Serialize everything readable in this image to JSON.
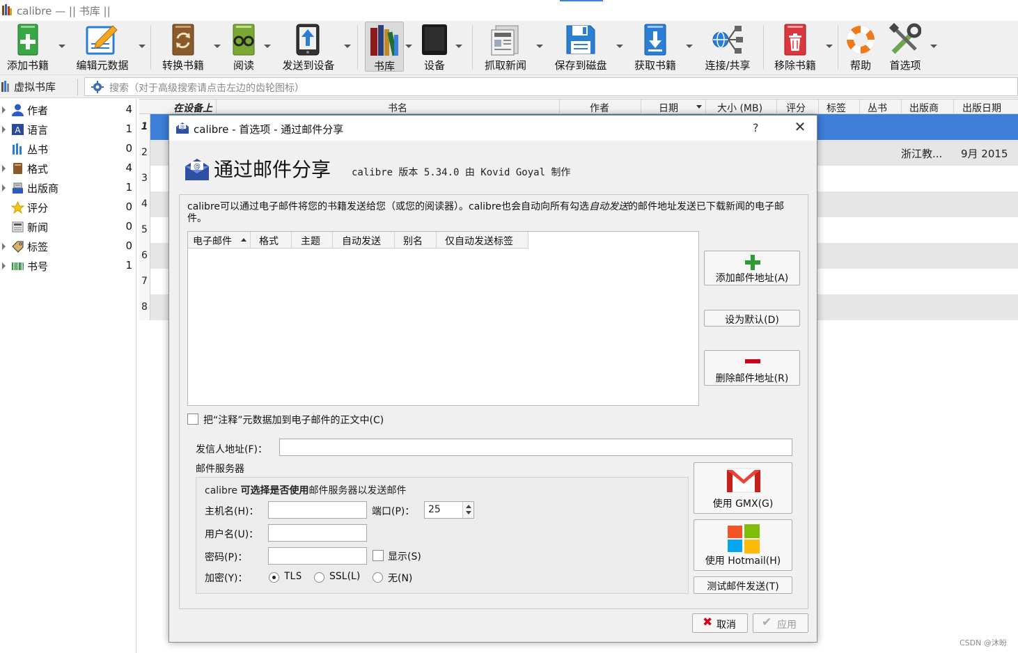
{
  "window": {
    "title": "calibre — || 书库 ||"
  },
  "toolbar": {
    "add_books": "添加书籍",
    "edit_metadata": "编辑元数据",
    "convert_books": "转换书籍",
    "view": "阅读",
    "send_to_device": "发送到设备",
    "library": "书库",
    "device": "设备",
    "fetch_news": "抓取新闻",
    "save_to_disk": "保存到磁盘",
    "get_books": "获取书籍",
    "connect_share": "连接/共享",
    "remove_books": "移除书籍",
    "help": "帮助",
    "preferences": "首选项"
  },
  "search": {
    "virtual_library": "虚拟书库",
    "placeholder": "搜索（对于高级搜索请点击左边的齿轮图标）"
  },
  "tag_browser": {
    "items": [
      {
        "label": "作者",
        "count": "4",
        "expandable": true,
        "icon": "user-icon"
      },
      {
        "label": "语言",
        "count": "1",
        "expandable": true,
        "icon": "language-icon"
      },
      {
        "label": "丛书",
        "count": "0",
        "expandable": false,
        "icon": "series-icon"
      },
      {
        "label": "格式",
        "count": "4",
        "expandable": true,
        "icon": "book-format-icon"
      },
      {
        "label": "出版商",
        "count": "1",
        "expandable": true,
        "icon": "publisher-icon"
      },
      {
        "label": "评分",
        "count": "0",
        "expandable": false,
        "icon": "star-icon"
      },
      {
        "label": "新闻",
        "count": "0",
        "expandable": false,
        "icon": "news-icon"
      },
      {
        "label": "标签",
        "count": "0",
        "expandable": true,
        "icon": "tag-icon"
      },
      {
        "label": "书号",
        "count": "1",
        "expandable": true,
        "icon": "barcode-icon"
      }
    ]
  },
  "book_list": {
    "columns": {
      "on_device": "在设备上",
      "title": "书名",
      "author": "作者",
      "date": "日期",
      "size": "大小 (MB)",
      "rating": "评分",
      "tags": "标签",
      "series": "丛书",
      "publisher": "出版商",
      "pubdate": "出版日期"
    },
    "row_numbers": [
      "1",
      "2",
      "3",
      "4",
      "5",
      "6",
      "7",
      "8"
    ],
    "row2": {
      "publisher": "浙江教...",
      "pubdate": "9月 2015"
    }
  },
  "dialog": {
    "title": "calibre - 首选项 - 通过邮件分享",
    "help": "?",
    "close": "✕",
    "heading": "通过邮件分享",
    "subheading": "calibre 版本 5.34.0 由 Kovid Goyal 制作",
    "description_part1": "calibre可以通过电子邮件将您的书籍发送给您（或您的阅读器）。calibre也会自动向所有勾选",
    "description_em": "自动发送",
    "description_part2": "的邮件地址发送已下载新闻的电子邮件。",
    "table_headers": {
      "email": "电子邮件",
      "formats": "格式",
      "subject": "主题",
      "auto_send": "自动发送",
      "alias": "别名",
      "auto_send_tags": "仅自动发送标签"
    },
    "add_email": "添加邮件地址(A)",
    "make_default": "设为默认(D)",
    "remove_email": "删除邮件地址(R)",
    "add_comments": "把“注释”元数据加到电子邮件的正文中(C)",
    "send_from_label": "发信人地址(F)：",
    "send_from_value": "",
    "mail_server_label": "邮件服务器",
    "server_desc_part1": "calibre ",
    "server_desc_bold": "可选择是否使用",
    "server_desc_part2": "邮件服务器以发送邮件",
    "hostname_label": "主机名(H)：",
    "hostname_value": "",
    "port_label": "端口(P)：",
    "port_value": "25",
    "username_label": "用户名(U)：",
    "username_value": "",
    "password_label": "密码(P)：",
    "password_value": "",
    "show_label": "显示(S)",
    "encryption_label": "加密(Y)：",
    "enc_tls": "TLS",
    "enc_ssl": "SSL(L)",
    "enc_none": "无(N)",
    "use_gmx": "使用 GMX(G)",
    "use_hotmail": "使用 Hotmail(H)",
    "test_email": "测试邮件发送(T)",
    "cancel": "取消",
    "apply": "应用"
  },
  "watermark": "CSDN @沐昐",
  "colors": {
    "accent": "#3d7ed9",
    "add_green": "#2e9b3a",
    "remove_red": "#d0021b"
  }
}
